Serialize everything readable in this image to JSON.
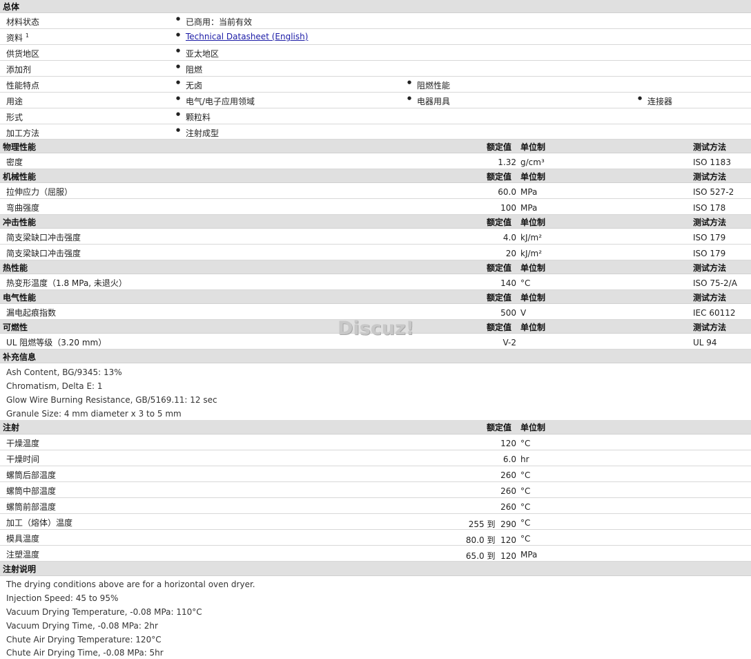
{
  "general": {
    "title": "总体",
    "rows": [
      {
        "label": "材料状态",
        "values": [
          "已商用：当前有效"
        ]
      },
      {
        "label": "资料",
        "sup": "1",
        "values": [
          "Technical Datasheet (English)"
        ]
      },
      {
        "label": "供货地区",
        "values": [
          "亚太地区"
        ]
      },
      {
        "label": "添加剂",
        "values": [
          "阻燃"
        ]
      },
      {
        "label": "性能特点",
        "values": [
          "无卤",
          "阻燃性能"
        ]
      },
      {
        "label": "用途",
        "values": [
          "电气/电子应用领域",
          "电器用具",
          "连接器"
        ]
      },
      {
        "label": "形式",
        "values": [
          "颗粒料"
        ]
      },
      {
        "label": "加工方法",
        "values": [
          "注射成型"
        ]
      }
    ]
  },
  "headers": {
    "rated": "额定值",
    "unit": "单位制",
    "method": "测试方法"
  },
  "physical": {
    "title": "物理性能",
    "rows": [
      {
        "label": "密度",
        "value": "1.32",
        "unit": "g/cm³",
        "method": "ISO 1183"
      }
    ]
  },
  "mechanical": {
    "title": "机械性能",
    "rows": [
      {
        "label": "拉伸应力（屈服）",
        "value": "60.0",
        "unit": "MPa",
        "method": "ISO 527-2"
      },
      {
        "label": "弯曲强度",
        "value": "100",
        "unit": "MPa",
        "method": "ISO 178"
      }
    ]
  },
  "impact": {
    "title": "冲击性能",
    "rows": [
      {
        "label": "简支梁缺口冲击强度",
        "value": "4.0",
        "unit": "kJ/m²",
        "method": "ISO 179"
      },
      {
        "label": "简支梁缺口冲击强度",
        "value": "20",
        "unit": "kJ/m²",
        "method": "ISO 179"
      }
    ]
  },
  "thermal": {
    "title": "热性能",
    "rows": [
      {
        "label": "热变形温度（1.8 MPa, 未退火）",
        "value": "140",
        "unit": "°C",
        "method": "ISO 75-2/A"
      }
    ]
  },
  "electrical": {
    "title": "电气性能",
    "rows": [
      {
        "label": "漏电起痕指数",
        "value": "500",
        "unit": "V",
        "method": "IEC 60112"
      }
    ]
  },
  "flammability": {
    "title": "可燃性",
    "rows": [
      {
        "label": "UL 阻燃等级（3.20 mm）",
        "value": "V-2",
        "unit": "",
        "method": "UL 94"
      }
    ]
  },
  "supplement": {
    "title": "补充信息",
    "lines": [
      "Ash Content, BG/9345: 13%",
      "Chromatism, Delta E: 1",
      "Glow Wire Burning Resistance, GB/5169.11: 12 sec",
      "Granule Size: 4 mm diameter x 3 to 5 mm"
    ]
  },
  "injection": {
    "title": "注射",
    "rows": [
      {
        "label": "干燥温度",
        "value": "120",
        "unit": "°C"
      },
      {
        "label": "干燥时间",
        "value": "6.0",
        "unit": "hr"
      },
      {
        "label": "螺筒后部温度",
        "value": "260",
        "unit": "°C"
      },
      {
        "label": "螺筒中部温度",
        "value": "260",
        "unit": "°C"
      },
      {
        "label": "螺筒前部温度",
        "value": "260",
        "unit": "°C"
      },
      {
        "label": "加工（熔体）温度",
        "value": "255 到  290",
        "unit": "°C"
      },
      {
        "label": "模具温度",
        "value": "80.0 到  120",
        "unit": "°C"
      },
      {
        "label": "注塑温度",
        "value": "65.0 到  120",
        "unit": "MPa"
      }
    ]
  },
  "injection_notes": {
    "title": "注射说明",
    "lines": [
      "The drying conditions above are for a horizontal oven dryer.",
      "Injection Speed: 45 to 95%",
      "Vacuum Drying Temperature, -0.08 MPa: 110°C",
      "Vacuum Drying Time, -0.08 MPa: 2hr",
      "Chute Air Drying Temperature: 120°C",
      "Chute Air Drying Time, -0.08 MPa: 5hr"
    ]
  },
  "watermark": "Discuz!"
}
